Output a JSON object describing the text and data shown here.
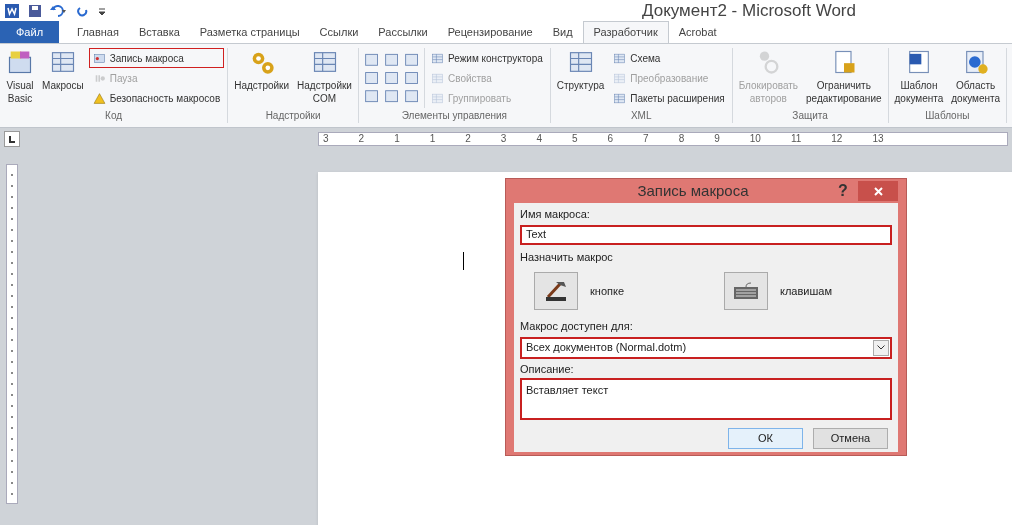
{
  "window": {
    "title": "Документ2 - Microsoft Word"
  },
  "tabs": [
    {
      "label": "Файл",
      "kind": "file",
      "selected": false
    },
    {
      "label": "Главная",
      "kind": "tab",
      "selected": false
    },
    {
      "label": "Вставка",
      "kind": "tab",
      "selected": false
    },
    {
      "label": "Разметка страницы",
      "kind": "tab",
      "selected": false
    },
    {
      "label": "Ссылки",
      "kind": "tab",
      "selected": false
    },
    {
      "label": "Рассылки",
      "kind": "tab",
      "selected": false
    },
    {
      "label": "Рецензирование",
      "kind": "tab",
      "selected": false
    },
    {
      "label": "Вид",
      "kind": "tab",
      "selected": false
    },
    {
      "label": "Разработчик",
      "kind": "tab",
      "selected": true
    },
    {
      "label": "Acrobat",
      "kind": "tab",
      "selected": false
    }
  ],
  "ribbon": {
    "code": {
      "label": "Код",
      "large": [
        {
          "label": "Visual Basic"
        },
        {
          "label": "Макросы"
        }
      ],
      "small": [
        {
          "label": "Запись макроса",
          "disabled": false,
          "highlighted": true
        },
        {
          "label": "Пауза",
          "disabled": true,
          "highlighted": false
        },
        {
          "label": "Безопасность макросов",
          "disabled": false,
          "highlighted": false
        }
      ]
    },
    "addins": {
      "label": "Надстройки",
      "large": [
        {
          "label": "Надстройки"
        },
        {
          "label": "Надстройки COM"
        }
      ]
    },
    "controls": {
      "label": "Элементы управления",
      "small": [
        {
          "label": "Режим конструктора",
          "disabled": false
        },
        {
          "label": "Свойства",
          "disabled": true
        },
        {
          "label": "Группировать",
          "disabled": true
        }
      ]
    },
    "xml": {
      "label": "XML",
      "large": [
        {
          "label": "Структура"
        }
      ],
      "small": [
        {
          "label": "Схема",
          "disabled": false
        },
        {
          "label": "Преобразование",
          "disabled": true
        },
        {
          "label": "Пакеты расширения",
          "disabled": false
        }
      ]
    },
    "protect": {
      "label": "Защита",
      "large": [
        {
          "label": "Блокировать авторов",
          "disabled": true
        },
        {
          "label": "Ограничить редактирование",
          "disabled": false
        }
      ]
    },
    "templates": {
      "label": "Шаблоны",
      "large": [
        {
          "label": "Шаблон документа"
        },
        {
          "label": "Область документа"
        }
      ]
    }
  },
  "ruler": {
    "labels": [
      "3",
      "2",
      "1",
      "1",
      "2",
      "3",
      "4",
      "5",
      "6",
      "7",
      "8",
      "9",
      "10",
      "11",
      "12",
      "13"
    ]
  },
  "dialog": {
    "title": "Запись макроса",
    "help": "?",
    "name_label": "Имя макроса:",
    "name_value": "Text",
    "assign_label": "Назначить макрос",
    "assign_buttons": [
      {
        "label": "кнопке"
      },
      {
        "label": "клавишам"
      }
    ],
    "scope_label": "Макрос доступен для:",
    "scope_value": "Всех документов (Normal.dotm)",
    "desc_label": "Описание:",
    "desc_value": "Вставляет текст",
    "buttons": [
      {
        "label": "ОК",
        "default": true
      },
      {
        "label": "Отмена",
        "default": false
      }
    ]
  }
}
